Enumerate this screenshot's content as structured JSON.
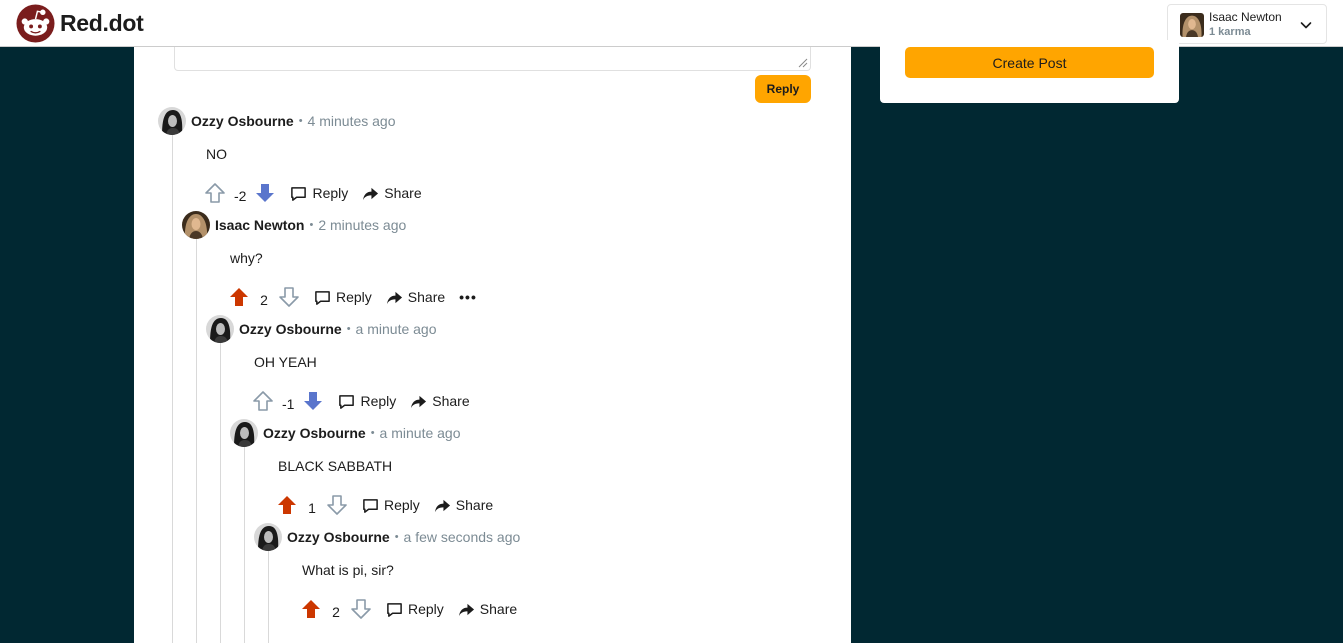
{
  "header": {
    "brand": "Red.dot",
    "user": {
      "name": "Isaac Newton",
      "karma": "1 karma"
    }
  },
  "composer": {
    "reply_label": "Reply"
  },
  "sidebar": {
    "create_post_label": "Create Post"
  },
  "colors": {
    "upvoted": "#cc3700",
    "downvoted": "#5a75cc",
    "accent": "#ffa500",
    "background": "#012832"
  },
  "comments": [
    {
      "author": "Ozzy Osbourne",
      "time": "4 minutes ago",
      "text": "NO",
      "score": "-2",
      "vote": "down",
      "reply": "Reply",
      "share": "Share"
    },
    {
      "author": "Isaac Newton",
      "time": "2 minutes ago",
      "text": "why?",
      "score": "2",
      "vote": "up",
      "reply": "Reply",
      "share": "Share",
      "more": "•••"
    },
    {
      "author": "Ozzy Osbourne",
      "time": "a minute ago",
      "text": "OH YEAH",
      "score": "-1",
      "vote": "down",
      "reply": "Reply",
      "share": "Share"
    },
    {
      "author": "Ozzy Osbourne",
      "time": "a minute ago",
      "text": "BLACK SABBATH",
      "score": "1",
      "vote": "up",
      "reply": "Reply",
      "share": "Share"
    },
    {
      "author": "Ozzy Osbourne",
      "time": "a few seconds ago",
      "text": "What is pi, sir?",
      "score": "2",
      "vote": "up",
      "reply": "Reply",
      "share": "Share"
    }
  ]
}
